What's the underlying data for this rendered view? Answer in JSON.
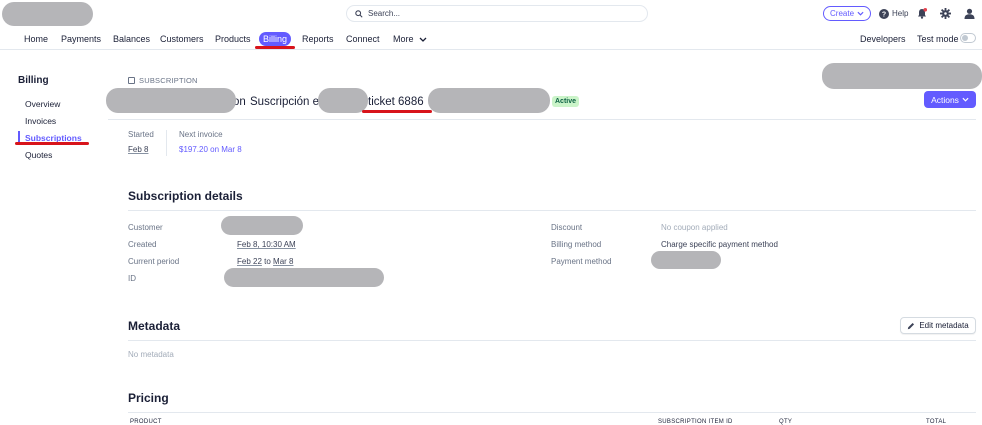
{
  "topbar": {
    "search_placeholder": "Search...",
    "create_label": "Create",
    "help_label": "Help"
  },
  "nav": {
    "items": [
      {
        "label": "Home"
      },
      {
        "label": "Payments"
      },
      {
        "label": "Balances"
      },
      {
        "label": "Customers"
      },
      {
        "label": "Products"
      },
      {
        "label": "Billing",
        "active": true
      },
      {
        "label": "Reports"
      },
      {
        "label": "Connect"
      },
      {
        "label": "More"
      }
    ],
    "developers_label": "Developers",
    "test_mode_label": "Test mode"
  },
  "sidebar": {
    "title": "Billing",
    "items": [
      {
        "label": "Overview"
      },
      {
        "label": "Invoices"
      },
      {
        "label": "Subscriptions",
        "active": true
      },
      {
        "label": "Quotes"
      }
    ]
  },
  "header": {
    "breadcrumb": "SUBSCRIPTION",
    "title_fragment_1": "on",
    "title_fragment_2": "Suscripción e",
    "title_fragment_3": "ticket 6886",
    "status_badge": "Active",
    "actions_label": "Actions"
  },
  "summary": {
    "started_label": "Started",
    "started_value": "Feb 8",
    "next_invoice_label": "Next invoice",
    "next_invoice_value": "$197.20 on Mar 8"
  },
  "details": {
    "title": "Subscription details",
    "customer_label": "Customer",
    "created_label": "Created",
    "created_value": "Feb 8, 10:30 AM",
    "current_period_label": "Current period",
    "period_start": "Feb 22",
    "period_to": "to",
    "period_end": "Mar 8",
    "id_label": "ID",
    "discount_label": "Discount",
    "discount_value": "No coupon applied",
    "billing_method_label": "Billing method",
    "billing_method_value": "Charge specific payment method",
    "payment_method_label": "Payment method"
  },
  "metadata": {
    "title": "Metadata",
    "edit_label": "Edit metadata",
    "empty_text": "No metadata"
  },
  "pricing": {
    "title": "Pricing",
    "columns": [
      "PRODUCT",
      "SUBSCRIPTION ITEM ID",
      "QTY",
      "TOTAL"
    ]
  },
  "colors": {
    "accent": "#635bff",
    "annotation_red": "#d8141b",
    "redaction_gray": "#b5b5b8",
    "badge_green_bg": "#cbf4c9",
    "badge_green_text": "#0e6245"
  }
}
